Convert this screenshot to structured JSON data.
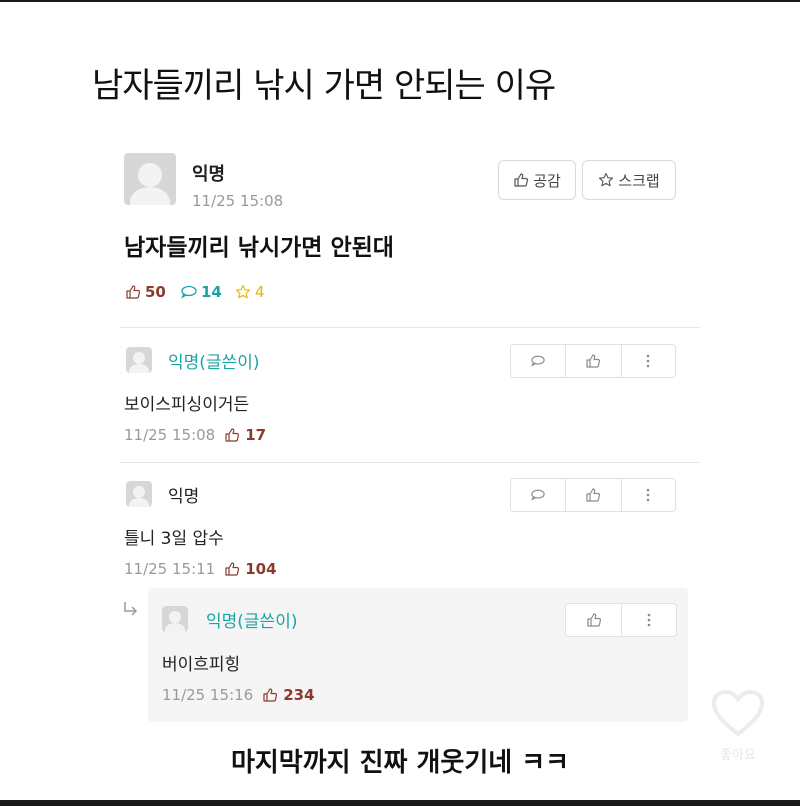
{
  "headline": "남자들끼리 낚시 가면 안되는 이유",
  "post": {
    "author": "익명",
    "time": "11/25 15:08",
    "title": "남자들끼리 낚시가면 안된대",
    "like_button": "공감",
    "scrap_button": "스크랩",
    "likes": "50",
    "comments": "14",
    "scraps": "4"
  },
  "comments": [
    {
      "author": "익명(글쓴이)",
      "text": "보이스피싱이거든",
      "time": "11/25 15:08",
      "likes": "17"
    },
    {
      "author": "익명",
      "text": "틀니 3일 압수",
      "time": "11/25 15:11",
      "likes": "104"
    }
  ],
  "reply": {
    "author": "익명(글쓴이)",
    "text": "버이흐피힝",
    "time": "11/25 15:16",
    "likes": "234"
  },
  "caption": "마지막까지 진짜 개웃기네 ㅋㅋ",
  "watermark": "좋아요",
  "colors": {
    "writer": "#1aa4a8",
    "likes": "#8a3b2b",
    "star": "#e8b400"
  },
  "icons": [
    "thumbs-up-icon",
    "star-icon",
    "comment-bubble-icon",
    "more-vertical-icon",
    "reply-arrow-icon",
    "heart-icon"
  ]
}
